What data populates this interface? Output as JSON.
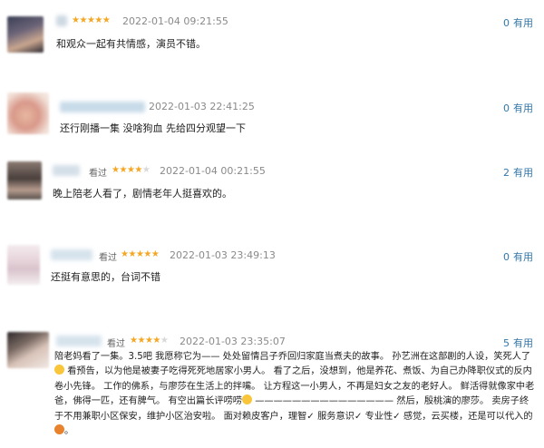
{
  "reviews": [
    {
      "seen_label": "",
      "rating": 5,
      "date": "2022-01-04 09:21:55",
      "useful_count": "0",
      "useful_label": "有用",
      "text": "和观众一起有共情感，演员不错。"
    },
    {
      "seen_label": "",
      "rating": 0,
      "date": "2022-01-03 22:41:25",
      "useful_count": "0",
      "useful_label": "有用",
      "text": "还行刚播一集 没啥狗血 先给四分观望一下"
    },
    {
      "seen_label": "看过",
      "rating": 4,
      "date": "2022-01-04 00:21:55",
      "useful_count": "2",
      "useful_label": "有用",
      "text": "晚上陪老人看了，剧情老年人挺喜欢的。"
    },
    {
      "seen_label": "看过",
      "rating": 5,
      "date": "2022-01-03 23:49:13",
      "useful_count": "0",
      "useful_label": "有用",
      "text": "还挺有意思的，台词不错"
    },
    {
      "seen_label": "看过",
      "rating": 4,
      "date": "2022-01-03 23:35:07",
      "useful_count": "5",
      "useful_label": "有用",
      "text_parts": [
        "陪老妈看了一集。3.5吧 我愿称它为—— 处处留情吕子乔回归家庭当煮夫的故事。 孙艺洲在这部剧的人设，笑死人了",
        " 看预告，以为他是被妻子吃得死死地居家小男人。 看了之后，没想到，他是养花、煮饭、为自己办降职仪式的反内卷小先锋。 工作的佛系，与廖莎在生活上的拌嘴。 让方程这一小男人，不再是妇女之友的老好人。 鲜活得就像家中老爸，佛得一匹，还有脾气。 有空出篇长评唠唠",
        " ——————————————— 然后，殷桃演的廖莎。 卖房子终于不用兼职小区保安，维护小区治安啦。 面对赖皮客户，理智✓ 服务意识✓ 专业性✓ 感觉，云买楼，还是可以代入的",
        "。"
      ]
    }
  ]
}
